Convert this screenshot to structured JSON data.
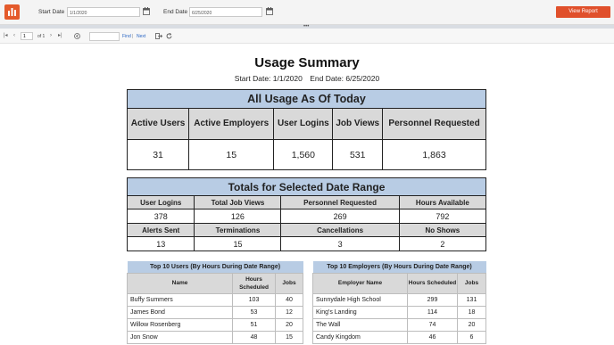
{
  "params": {
    "start_label": "Start Date",
    "start_value": "1/1/2020",
    "end_label": "End Date",
    "end_value": "6/25/2020",
    "view_button": "View Report"
  },
  "toolbar": {
    "page": "1",
    "of_text": "of 1",
    "find": "Find",
    "separator": "|",
    "next": "Next"
  },
  "report": {
    "title": "Usage Summary",
    "start_text": "Start Date: 1/1/2020",
    "end_text": "End Date: 6/25/2020"
  },
  "all_usage": {
    "header": "All Usage As Of Today",
    "columns": [
      "Active Users",
      "Active Employers",
      "User Logins",
      "Job Views",
      "Personnel Requested"
    ],
    "values": [
      "31",
      "15",
      "1,560",
      "531",
      "1,863"
    ]
  },
  "totals": {
    "header": "Totals for Selected Date Range",
    "row1_labels": [
      "User Logins",
      "Total Job Views",
      "Personnel Requested",
      "Hours Available"
    ],
    "row1_values": [
      "378",
      "126",
      "269",
      "792"
    ],
    "row2_labels": [
      "Alerts Sent",
      "Terminations",
      "Cancellations",
      "No Shows"
    ],
    "row2_values": [
      "13",
      "15",
      "3",
      "2"
    ]
  },
  "top_users": {
    "header": "Top 10 Users (By Hours During Date Range)",
    "columns": [
      "Name",
      "Hours Scheduled",
      "Jobs"
    ],
    "rows": [
      [
        "Buffy Summers",
        "103",
        "40"
      ],
      [
        "James Bond",
        "53",
        "12"
      ],
      [
        "Willow Rosenberg",
        "51",
        "20"
      ],
      [
        "Jon Snow",
        "48",
        "15"
      ]
    ]
  },
  "top_employers": {
    "header": "Top 10 Employers (By Hours During Date Range)",
    "columns": [
      "Employer Name",
      "Hours Scheduled",
      "Jobs"
    ],
    "rows": [
      [
        "Sunnydale High School",
        "299",
        "131"
      ],
      [
        "King's Landing",
        "114",
        "18"
      ],
      [
        "The Wall",
        "74",
        "20"
      ],
      [
        "Candy Kingdom",
        "46",
        "6"
      ]
    ]
  },
  "colors": {
    "accent": "#e0502b",
    "header_blue": "#b8cce4",
    "column_gray": "#d9d9d9"
  }
}
